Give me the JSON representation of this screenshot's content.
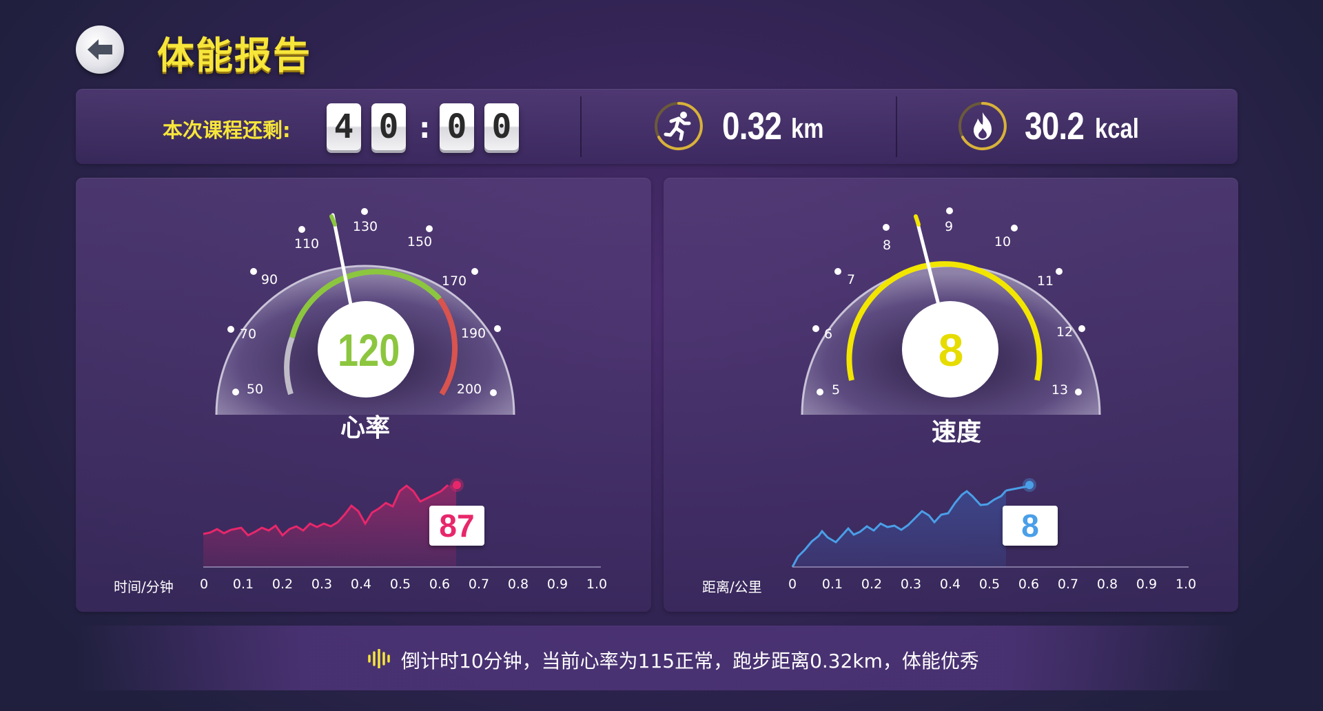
{
  "header": {
    "title": "体能报告",
    "back_icon": "back-arrow-icon"
  },
  "summary": {
    "timer_label": "本次课程还剩:",
    "timer_digits": [
      "4",
      "0",
      "0",
      "0"
    ],
    "timer_separator": ":",
    "distance": {
      "value": "0.32",
      "unit": "km",
      "icon": "running-person-icon"
    },
    "calories": {
      "value": "30.2",
      "unit": "kcal",
      "icon": "flame-icon"
    }
  },
  "heart_rate": {
    "title": "心率",
    "value": "120",
    "scale_labels": [
      "50",
      "70",
      "90",
      "110",
      "130",
      "150",
      "170",
      "190",
      "200"
    ],
    "chart": {
      "axis_label": "时间/分钟",
      "x_ticks": [
        "0",
        "0.1",
        "0.2",
        "0.3",
        "0.4",
        "0.5",
        "0.6",
        "0.7",
        "0.8",
        "0.9",
        "1.0"
      ],
      "current_value": "87",
      "color": "#e8276b"
    }
  },
  "speed": {
    "title": "速度",
    "value": "8",
    "scale_labels": [
      "5",
      "6",
      "7",
      "8",
      "9",
      "10",
      "11",
      "12",
      "13"
    ],
    "chart": {
      "axis_label": "距离/公里",
      "x_ticks": [
        "0",
        "0.1",
        "0.2",
        "0.3",
        "0.4",
        "0.5",
        "0.6",
        "0.7",
        "0.8",
        "0.9",
        "1.0"
      ],
      "current_value": "8",
      "color": "#4a9fe8"
    }
  },
  "footer": {
    "voice_icon": "sound-wave-icon",
    "message": "倒计时10分钟，当前心率为115正常，跑步距离0.32km，体能优秀"
  },
  "colors": {
    "accent_yellow": "#f7e63a",
    "hr_green": "#8cc63f",
    "hr_red": "#d9534f",
    "speed_yellow": "#f2e600"
  }
}
